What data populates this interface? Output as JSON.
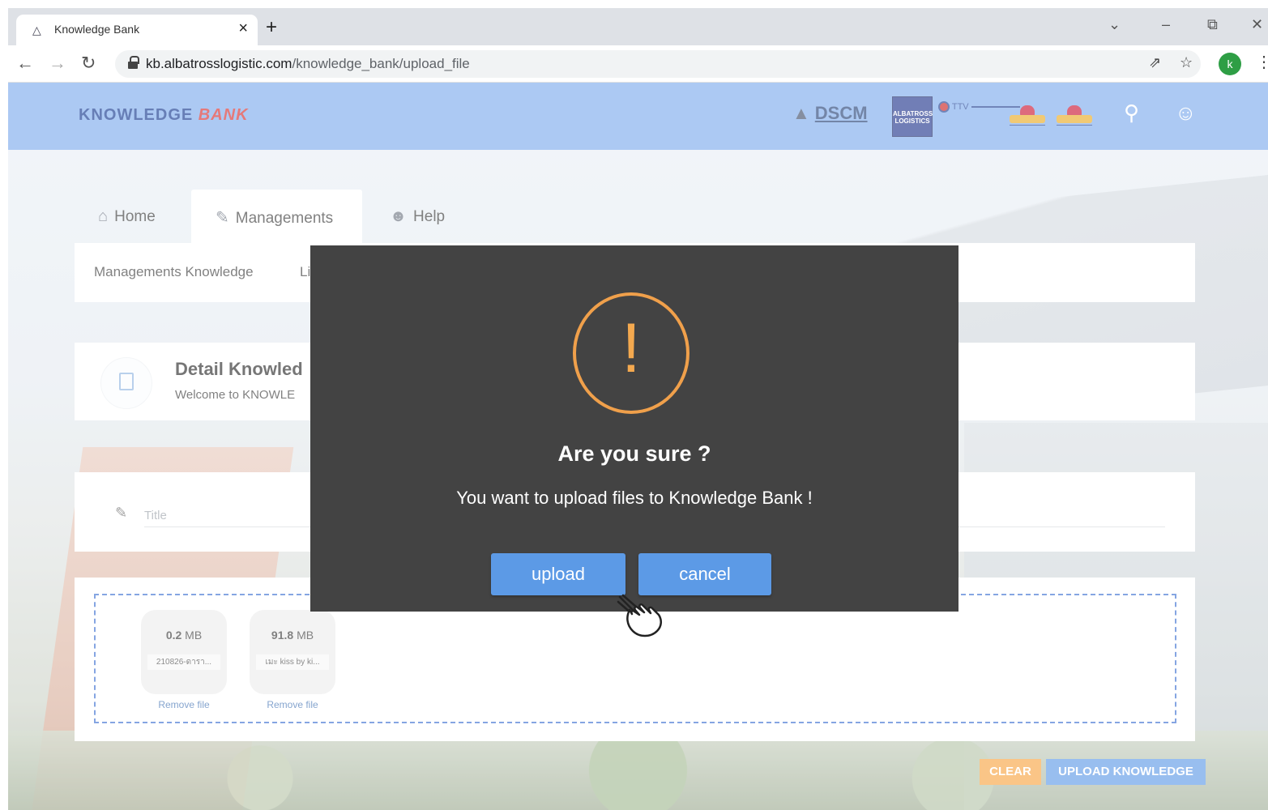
{
  "browser": {
    "tab_title": "Knowledge Bank",
    "url_host": "kb.albatrosslogistic.com",
    "url_path": "/knowledge_bank/upload_file",
    "profile_initial": "k"
  },
  "header": {
    "logo_part1": "KNOWLEDGE",
    "logo_part2": "BANK",
    "brand_dscm": "DSCM"
  },
  "nav_tabs": [
    {
      "label": "Home",
      "icon": "home-icon"
    },
    {
      "label": "Managements",
      "icon": "pencil-icon"
    },
    {
      "label": "Help",
      "icon": "help-icon"
    }
  ],
  "subnav": {
    "items": [
      "Managements Knowledge",
      "Li"
    ]
  },
  "detail": {
    "title": "Detail Knowled",
    "subtitle": "Welcome to KNOWLE"
  },
  "form": {
    "title_placeholder": "Title"
  },
  "files": [
    {
      "size_value": "0.2",
      "size_unit": "MB",
      "name": "210826-ดารา...",
      "remove_label": "Remove file"
    },
    {
      "size_value": "91.8",
      "size_unit": "MB",
      "name": "เมะ kiss by ki...",
      "remove_label": "Remove file"
    }
  ],
  "actions": {
    "clear_label": "CLEAR",
    "upload_label": "UPLOAD KNOWLEDGE"
  },
  "modal": {
    "icon": "warning-icon",
    "title": "Are you sure ?",
    "message": "You want to upload files to Knowledge Bank !",
    "confirm_label": "upload",
    "cancel_label": "cancel"
  },
  "colors": {
    "header_bg": "#79a9ec",
    "modal_bg": "#434343",
    "warning": "#f0a04b",
    "button_primary": "#5c9ae6",
    "clear_button": "#f7a23e"
  }
}
